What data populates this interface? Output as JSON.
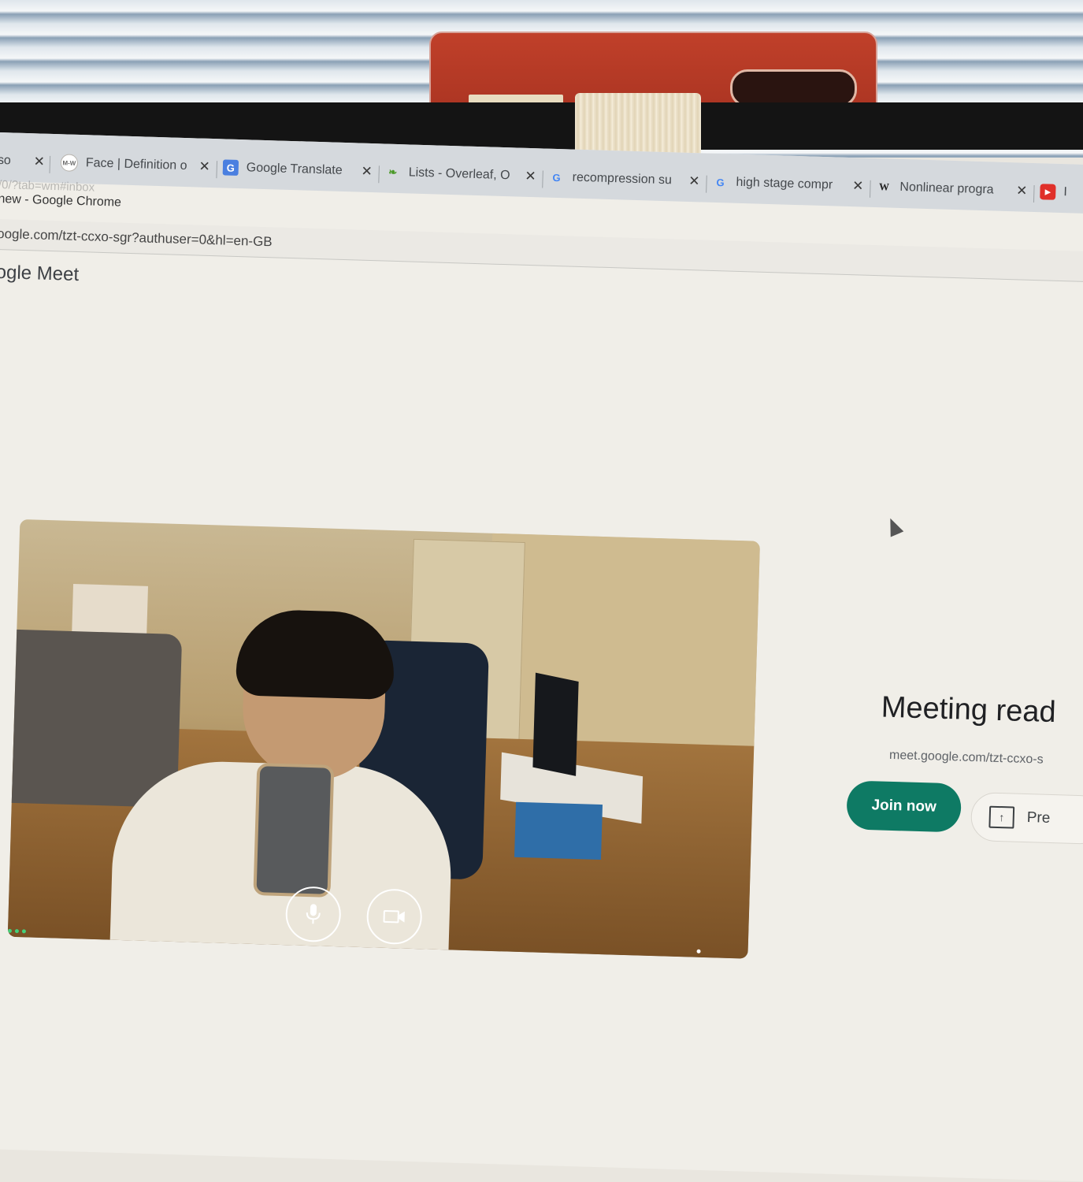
{
  "tabs": [
    {
      "title": "so",
      "favicon": "generic-icon"
    },
    {
      "title": "Face | Definition o",
      "favicon": "merriam-webster-icon",
      "favicon_text": "M-W"
    },
    {
      "title": "Google Translate",
      "favicon": "google-translate-icon"
    },
    {
      "title": "Lists - Overleaf, O",
      "favicon": "overleaf-icon"
    },
    {
      "title": "recompression su",
      "favicon": "google-icon",
      "favicon_text": "G"
    },
    {
      "title": "high stage compr",
      "favicon": "google-icon",
      "favicon_text": "G"
    },
    {
      "title": "Nonlinear progra",
      "favicon": "wikipedia-icon",
      "favicon_text": "W"
    },
    {
      "title": "I",
      "favicon": "youtube-icon"
    }
  ],
  "tab_close_glyph": "✕",
  "background_url_fragment": "/0/?tab=wm#inbox",
  "window_title": "new - Google Chrome",
  "address_url": "oogle.com/tzt-ccxo-sgr?authuser=0&hl=en-GB",
  "meet": {
    "header": "ogle Meet",
    "status_title": "Meeting read",
    "meeting_link": "meet.google.com/tzt-ccxo-s",
    "join_button": "Join now",
    "present_button": "Pre"
  },
  "preview_controls": {
    "mic_icon": "microphone-icon",
    "camera_icon": "video-camera-icon",
    "more_icon": "more-vertical-icon"
  },
  "colors": {
    "join_accent": "#0e7a64",
    "speaking_indicator": "#43d17a"
  }
}
